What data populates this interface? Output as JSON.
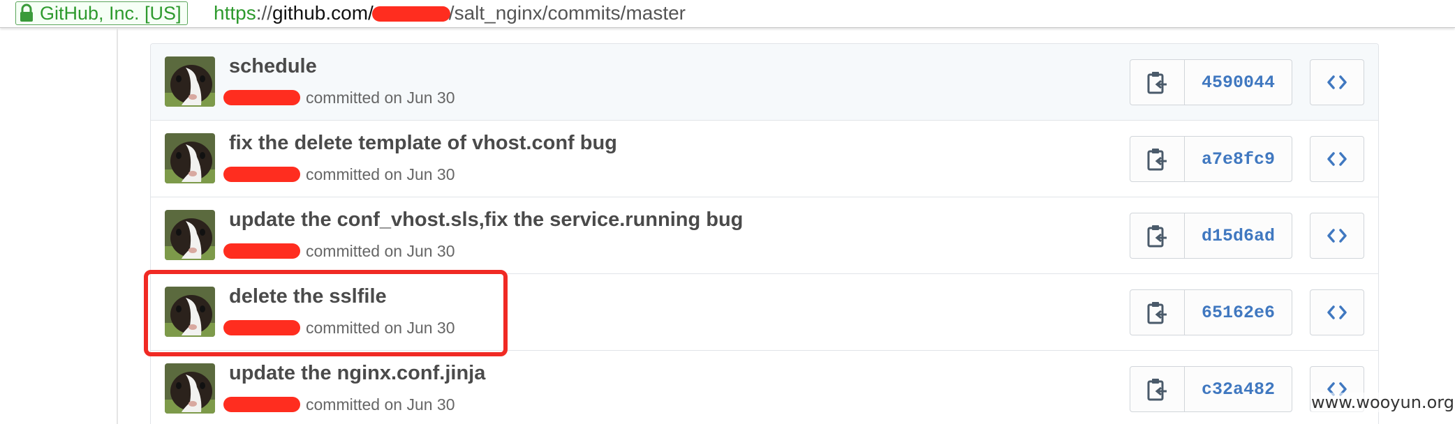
{
  "browser": {
    "ev_label": "GitHub, Inc. [US]",
    "url_scheme": "https",
    "url_sep": "://",
    "url_host": "github.com/",
    "url_path": "/salt_nginx/commits/master"
  },
  "commits": [
    {
      "title": "schedule",
      "meta": "committed on Jun 30",
      "sha": "4590044"
    },
    {
      "title": "fix the delete template of vhost.conf bug",
      "meta": "committed on Jun 30",
      "sha": "a7e8fc9"
    },
    {
      "title": "update the conf_vhost.sls,fix the service.running bug",
      "meta": "committed on Jun 30",
      "sha": "d15d6ad"
    },
    {
      "title": "delete the sslfile",
      "meta": "committed on Jun 30",
      "sha": "65162e6"
    },
    {
      "title": "update the nginx.conf.jinja",
      "meta": "committed on Jun 30",
      "sha": "c32a482"
    }
  ],
  "watermark": "www.wooyun.org",
  "colors": {
    "ev_green": "#2e9a2e",
    "sha_blue": "#4078c0",
    "highlight_red": "#f02a24",
    "redaction_red": "#ff2d1f"
  },
  "icons": {
    "clipboard": "clipboard-icon",
    "browse": "code-brackets-icon",
    "lock": "lock-icon"
  }
}
